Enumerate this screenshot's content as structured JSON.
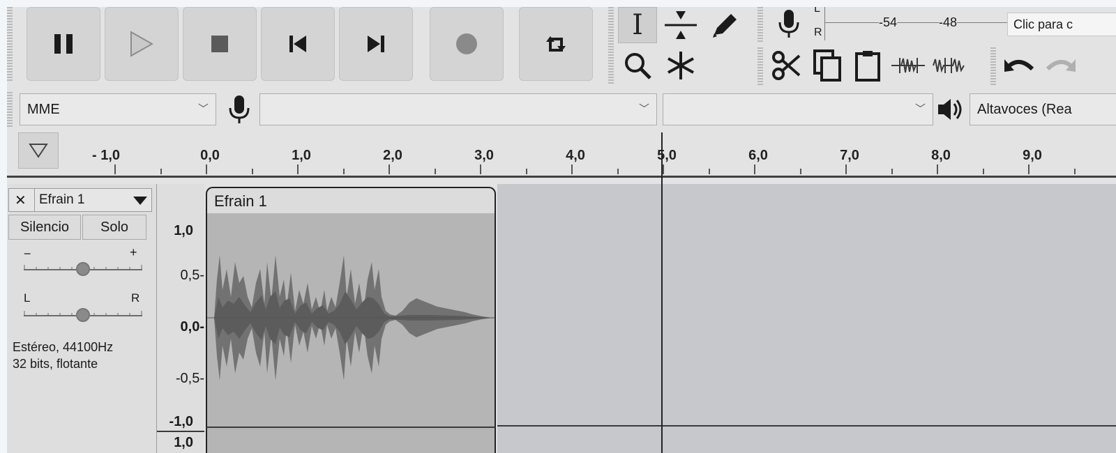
{
  "transport": {
    "pause": "pause-icon",
    "play": "play-icon",
    "stop": "stop-icon",
    "skip_start": "skip-to-start-icon",
    "skip_end": "skip-to-end-icon",
    "record": "record-icon",
    "loop": "loop-icon"
  },
  "tools": {
    "selection": "I",
    "envelope": "envelope-icon",
    "draw": "pencil-icon",
    "zoom": "magnifier-icon",
    "multi": "multi-tool-icon"
  },
  "meter": {
    "left_channel": "L",
    "right_channel": "R",
    "scale": [
      "-54",
      "-48"
    ],
    "hint": "Clic para c"
  },
  "edit_tools": [
    "cut-icon",
    "copy-icon",
    "paste-icon",
    "trim-icon",
    "silence-icon",
    "undo-icon",
    "redo-icon"
  ],
  "device": {
    "host": "MME",
    "input_device": "",
    "input_channels": "",
    "output_device": "Altavoces (Rea"
  },
  "ruler": {
    "labels": [
      "- 1,0",
      "0,0",
      "1,0",
      "2,0",
      "3,0",
      "4,0",
      "5,0",
      "6,0",
      "7,0",
      "8,0",
      "9,0"
    ],
    "playhead_seconds": 5.0
  },
  "track": {
    "name": "Efrain 1",
    "close": "✕",
    "mute_label": "Silencio",
    "solo_label": "Solo",
    "gain_minus": "−",
    "gain_plus": "+",
    "gain_value": 0.5,
    "pan_left": "L",
    "pan_right": "R",
    "pan_value": 0.5,
    "info_line1": "Estéreo, 44100Hz",
    "info_line2": "32 bits, flotante",
    "scale": [
      "1,0",
      "0,5-",
      "0,0-",
      "-0,5-",
      "-1,0",
      "1,0"
    ],
    "clip_name": "Efrain 1",
    "clip_start_seconds": 0.0,
    "clip_end_seconds": 3.15
  }
}
